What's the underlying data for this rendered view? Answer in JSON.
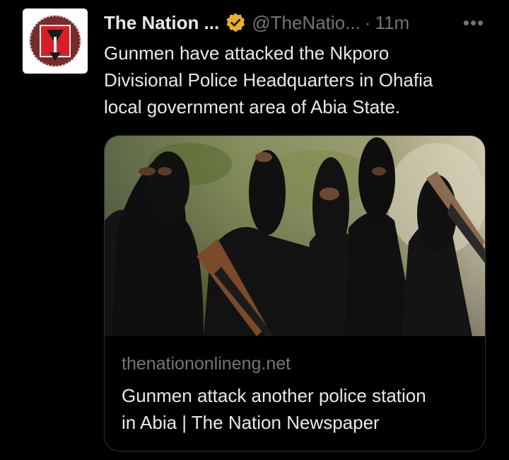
{
  "tweet": {
    "author_name": "The Nation ...",
    "handle": "@TheNatio...",
    "separator": "·",
    "time": "11m",
    "more_label": "•••",
    "text": "Gunmen have attacked the Nkporo\nDivisional Police Headquarters in Ohafia\nlocal government area of Abia State."
  },
  "card": {
    "domain": "thenationonlineng.net",
    "title": "Gunmen attack another police station\nin Abia | The Nation Newspaper"
  },
  "icons": {
    "avatar": "the-nation-logo",
    "verified": "verified-gold-badge-icon",
    "more": "more-options-icon"
  },
  "colors": {
    "background": "#000000",
    "primary_text": "#e7e9ea",
    "secondary_text": "#71767b",
    "verified_badge": "#e8b02a",
    "card_border": "#2f3336"
  }
}
